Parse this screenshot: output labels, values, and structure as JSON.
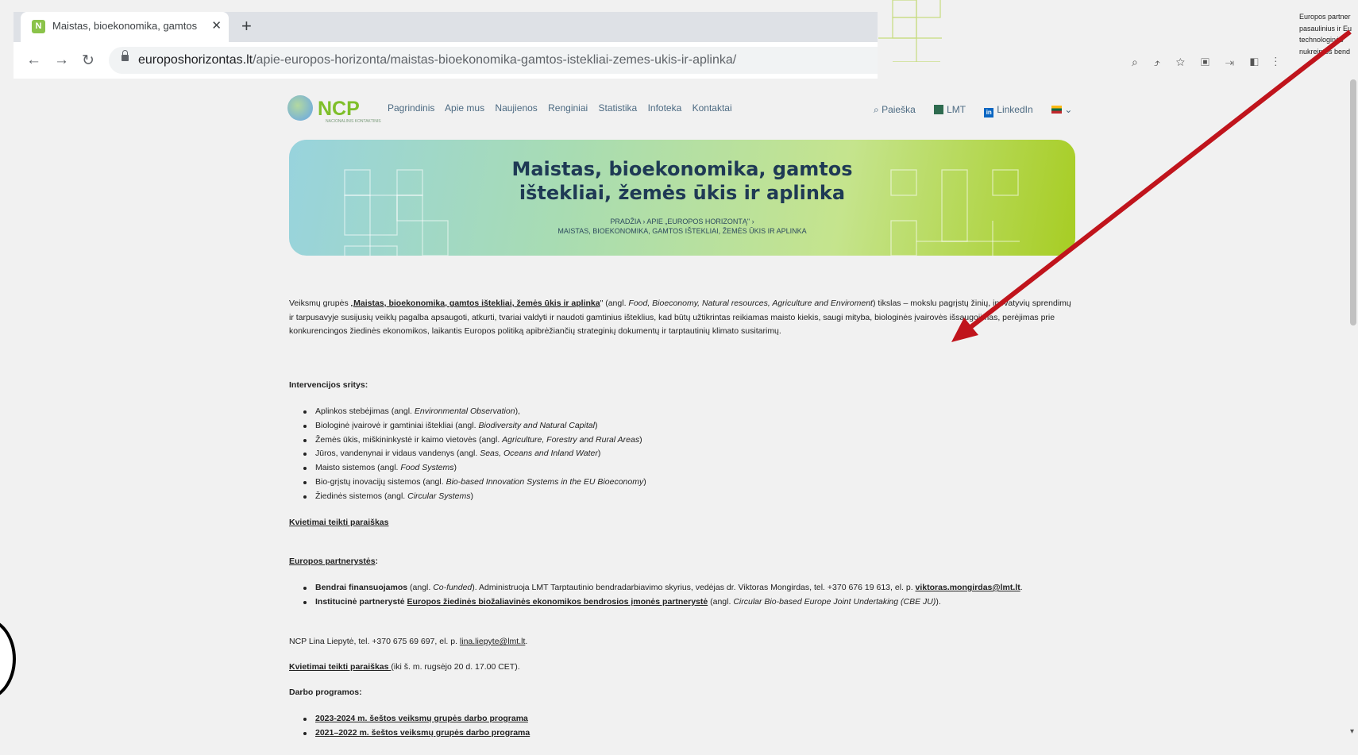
{
  "browser": {
    "tab_title": "Maistas, bioekonomika, gamtos",
    "favicon_letter": "N",
    "close_glyph": "✕",
    "new_tab_glyph": "+",
    "back_glyph": "←",
    "forward_glyph": "→",
    "reload_glyph": "↻",
    "url_host": "europoshorizontas.lt",
    "url_path": "/apie-europos-horizonta/maistas-bioekonomika-gamtos-istekliai-zemes-ukis-ir-aplinka/"
  },
  "overlay_note": {
    "lines": [
      "Europos partner",
      "pasaulinius ir Eu",
      "technologinės",
      "nukreiptos bend"
    ]
  },
  "header": {
    "logo_text": "NCP",
    "logo_sub": "NACIONALINIS KONTAKTINIS",
    "nav": [
      "Pagrindinis",
      "Apie mus",
      "Naujienos",
      "Renginiai",
      "Statistika",
      "Infoteka",
      "Kontaktai"
    ],
    "search_label": "Paieška",
    "lmt_label": "LMT",
    "linkedin_label": "LinkedIn",
    "linkedin_icon": "in",
    "search_icon": "⌕",
    "lang_chevron": "⌄"
  },
  "hero": {
    "title_line1": "Maistas, bioekonomika, gamtos",
    "title_line2": "ištekliai, žemės ūkis ir aplinka",
    "bc_home": "PRADŽIA",
    "bc_sep1": "›",
    "bc_parent": "APIE „EUROPOS HORIZONTĄ\"",
    "bc_sep2": "›",
    "bc_current": "MAISTAS, BIOEKONOMIKA, GAMTOS IŠTEKLIAI, ŽEMĖS ŪKIS IR APLINKA"
  },
  "intro": {
    "pre": "Veiksmų grupės „",
    "link": "Maistas, bioekonomika, gamtos ištekliai, žemės ūkis ir aplinka",
    "post1": "\" (angl. ",
    "en": "Food, Bioeconomy, Natural resources, Agriculture and Enviroment",
    "post2": ") tikslas – mokslu pagrįstų žinių, inovatyvių sprendimų ir tarpusavyje susijusių veiklų pagalba apsaugoti, atkurti, tvariai valdyti ir naudoti gamtinius išteklius, kad būtų užtikrintas reikiamas maisto kiekis, saugi mityba, biologinės įvairovės išsaugojimas, perėjimas prie konkurencingos žiedinės ekonomikos, laikantis Europos politiką apibrėžiančių strateginių dokumentų ir tarptautinių klimato susitarimų."
  },
  "interventions": {
    "heading": "Intervencijos sritys",
    "colon": ":",
    "items": [
      {
        "lt": "Aplinkos stebėjimas (angl. ",
        "en": "Environmental Observation",
        "end": "),"
      },
      {
        "lt": "Biologinė įvairovė ir gamtiniai ištekliai (angl. ",
        "en": "Biodiversity and Natural Capital",
        "end": ")"
      },
      {
        "lt": "Žemės ūkis, miškininkystė ir kaimo vietovės (angl. ",
        "en": "Agriculture, Forestry and Rural Areas",
        "end": ")"
      },
      {
        "lt": "Jūros, vandenynai ir vidaus vandenys (angl. ",
        "en": "Seas, Oceans and Inland Water",
        "end": ")"
      },
      {
        "lt": "Maisto sistemos (angl. ",
        "en": "Food Systems",
        "end": ")"
      },
      {
        "lt": "Bio-grįstų inovacijų sistemos (angl. ",
        "en": "Bio-based Innovation Systems in the EU Bioeconomy",
        "end": ")"
      },
      {
        "lt": "Žiedinės sistemos (angl. ",
        "en": "Circular Systems",
        "end": ")"
      }
    ]
  },
  "calls_link1": "Kvietimai teikti paraiškas",
  "partnerships": {
    "heading": "Europos partnerystės",
    "colon": ":",
    "item1_bold": "Bendrai finansuojamos",
    "item1_a": " (angl. ",
    "item1_en": "Co-funded",
    "item1_b": "). Administruoja LMT Tarptautinio bendradarbiavimo skyrius, vedėjas dr. Viktoras Mongirdas, tel. +370 676 19 613, el. p. ",
    "item1_email": "viktoras.mongirdas@lmt.lt",
    "item1_end": ".",
    "item2_bold": "Institucinė partnerystė ",
    "item2_link": "Europos žiedinės biožaliavinės ekonomikos bendrosios įmonės partnerystė",
    "item2_a": " (angl. ",
    "item2_en": "Circular Bio-based Europe Joint Undertaking (CBE JU)",
    "item2_end": ")."
  },
  "ncp_contact": {
    "text": "NCP Lina Liepytė, tel. +370 675 69 697, el. p. ",
    "email": "lina.liepyte@lmt.lt",
    "end": "."
  },
  "calls_link2": {
    "link": "Kvietimai teikti paraiškas ",
    "rest": "(iki š. m. rugsėjo 20 d. 17.00 CET)."
  },
  "work_programmes": {
    "heading": "Darbo programos:",
    "items": [
      "2023-2024 m. šeštos veiksmų grupės darbo programa",
      "2021–2022 m. šeštos veiksmų grupės darbo programa"
    ]
  },
  "colors": {
    "accent_red": "#c0141c",
    "hero_title": "#1f3a55",
    "nav": "#4c6a82",
    "logo_green": "#7fbf2a"
  }
}
